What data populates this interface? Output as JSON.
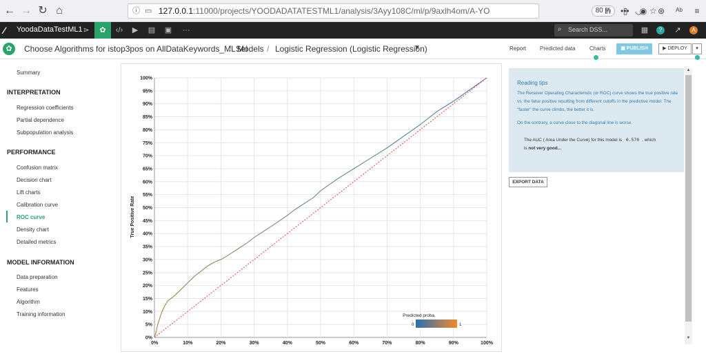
{
  "browser": {
    "url_host": "127.0.0.1",
    "url_path": ":11000/projects/YOODADATATESTML1/analysis/3Ayy108C/ml/p/9axlh4om/A-YO",
    "zoom": "80 %"
  },
  "dss": {
    "project_name": "YoodaDataTestML1",
    "search_placeholder": "Search DSS..."
  },
  "header": {
    "crumb1": "Choose Algorithms for istop3pos on AllDataKeywords_MLSel",
    "crumb2": "Models",
    "crumb3": "Logistic Regression (Logistic Regression)",
    "tabs": [
      {
        "label": "Report"
      },
      {
        "label": "Predicted data"
      },
      {
        "label": "Charts"
      }
    ],
    "publish": "PUBLISH",
    "deploy": "DEPLOY"
  },
  "sidebar": {
    "summary": "Summary",
    "sections": [
      {
        "title": "INTERPRETATION",
        "items": [
          "Regression coefficients",
          "Partial dependence",
          "Subpopulation analysis"
        ]
      },
      {
        "title": "PERFORMANCE",
        "items": [
          "Confusion matrix",
          "Decision chart",
          "Lift charts",
          "Calibration curve",
          "ROC curve",
          "Density chart",
          "Detailed metrics"
        ]
      },
      {
        "title": "MODEL INFORMATION",
        "items": [
          "Data preparation",
          "Features",
          "Algorithm",
          "Training information"
        ]
      }
    ],
    "active_item": "ROC curve"
  },
  "tips": {
    "title": "Reading tips",
    "p1": "The Receiver Operating Characteristic (or ROC) curve shows the true positive rate vs. the false positive resulting from different cutoffs in the predictive model. The \"faster\" the curve climbs, the better it is.",
    "p2": "On the contrary, a curve close to the diagonal line is worse.",
    "auc_pre": "The AUC ( Area Under the Curve) for this model is",
    "auc_value": "0.570",
    "auc_post": ", which",
    "auc_line2_pre": "is",
    "auc_line2_bold": "not very good..."
  },
  "export_label": "EXPORT DATA",
  "chart_data": {
    "type": "line",
    "ylabel": "True Positive Rate",
    "xlabel": "",
    "x_ticks": [
      "0%",
      "10%",
      "20%",
      "30%",
      "40%",
      "50%",
      "60%",
      "70%",
      "80%",
      "90%",
      "100%"
    ],
    "y_ticks": [
      "0%",
      "5%",
      "10%",
      "15%",
      "20%",
      "25%",
      "30%",
      "35%",
      "40%",
      "45%",
      "50%",
      "55%",
      "60%",
      "65%",
      "70%",
      "75%",
      "80%",
      "85%",
      "90%",
      "95%",
      "100%"
    ],
    "xlim": [
      0,
      1
    ],
    "ylim": [
      0,
      1
    ],
    "grid": true,
    "series": [
      {
        "x": [
          0,
          0.005,
          0.01,
          0.02,
          0.03,
          0.04,
          0.06,
          0.08,
          0.1,
          0.12,
          0.14,
          0.16,
          0.18,
          0.2,
          0.22,
          0.25,
          0.28,
          0.3,
          0.33,
          0.36,
          0.4,
          0.42,
          0.45,
          0.48,
          0.5,
          0.55,
          0.6,
          0.65,
          0.7,
          0.75,
          0.8,
          0.85,
          0.9,
          0.95,
          1.0
        ],
        "y": [
          0,
          0.02,
          0.05,
          0.09,
          0.12,
          0.14,
          0.16,
          0.185,
          0.21,
          0.235,
          0.255,
          0.275,
          0.29,
          0.3,
          0.315,
          0.34,
          0.365,
          0.385,
          0.41,
          0.435,
          0.47,
          0.49,
          0.515,
          0.54,
          0.565,
          0.61,
          0.65,
          0.69,
          0.73,
          0.775,
          0.82,
          0.87,
          0.91,
          0.955,
          1.0
        ],
        "style": "gradient-solid"
      },
      {
        "x": [
          0,
          1
        ],
        "y": [
          0,
          1
        ],
        "style": "diagonal-dotted",
        "color": "#e8413c"
      }
    ],
    "colorbar": {
      "label": "Predicted proba.",
      "min": "0",
      "max": "1",
      "from": "#2a6fb0",
      "to": "#ef8a2c"
    }
  }
}
